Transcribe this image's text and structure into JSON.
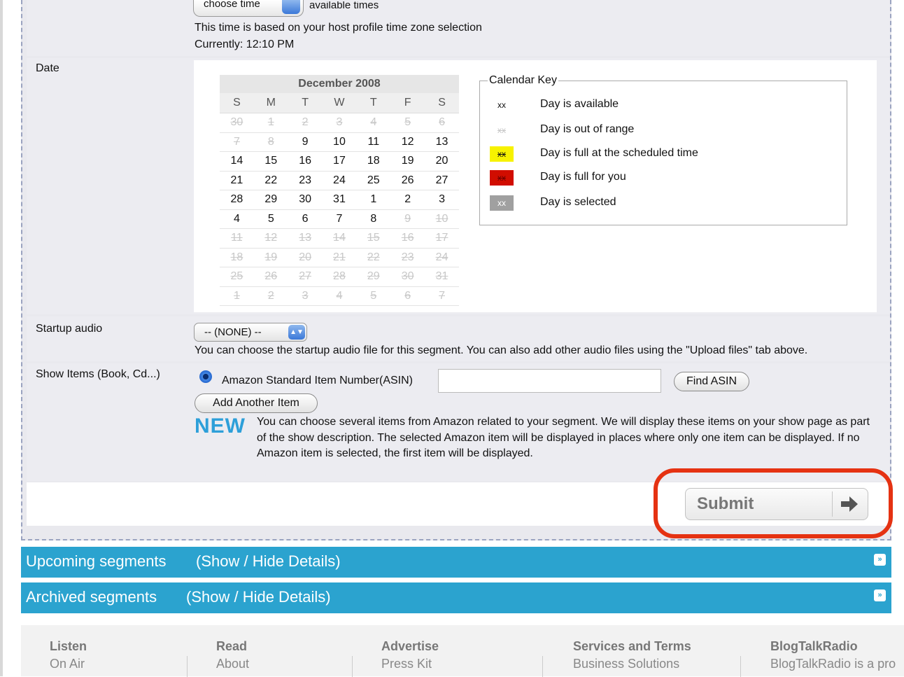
{
  "time_row": {
    "select_value": "choose time",
    "available_note": "available times",
    "note": "This time is based on your host profile time zone selection",
    "current": "Currently: 12:10 PM"
  },
  "date_row": {
    "label": "Date",
    "calendar": {
      "month": "December 2008",
      "weekdays": [
        "S",
        "M",
        "T",
        "W",
        "T",
        "F",
        "S"
      ],
      "weeks": [
        [
          {
            "d": "30",
            "out": true
          },
          {
            "d": "1",
            "out": true
          },
          {
            "d": "2",
            "out": true
          },
          {
            "d": "3",
            "out": true
          },
          {
            "d": "4",
            "out": true
          },
          {
            "d": "5",
            "out": true
          },
          {
            "d": "6",
            "out": true
          }
        ],
        [
          {
            "d": "7",
            "out": true
          },
          {
            "d": "8",
            "out": true
          },
          {
            "d": "9",
            "out": false
          },
          {
            "d": "10",
            "out": false
          },
          {
            "d": "11",
            "out": false
          },
          {
            "d": "12",
            "out": false
          },
          {
            "d": "13",
            "out": false
          }
        ],
        [
          {
            "d": "14",
            "out": false
          },
          {
            "d": "15",
            "out": false
          },
          {
            "d": "16",
            "out": false
          },
          {
            "d": "17",
            "out": false
          },
          {
            "d": "18",
            "out": false
          },
          {
            "d": "19",
            "out": false
          },
          {
            "d": "20",
            "out": false
          }
        ],
        [
          {
            "d": "21",
            "out": false
          },
          {
            "d": "22",
            "out": false
          },
          {
            "d": "23",
            "out": false
          },
          {
            "d": "24",
            "out": false
          },
          {
            "d": "25",
            "out": false
          },
          {
            "d": "26",
            "out": false
          },
          {
            "d": "27",
            "out": false
          }
        ],
        [
          {
            "d": "28",
            "out": false
          },
          {
            "d": "29",
            "out": false
          },
          {
            "d": "30",
            "out": false
          },
          {
            "d": "31",
            "out": false
          },
          {
            "d": "1",
            "out": false
          },
          {
            "d": "2",
            "out": false
          },
          {
            "d": "3",
            "out": false
          }
        ],
        [
          {
            "d": "4",
            "out": false
          },
          {
            "d": "5",
            "out": false
          },
          {
            "d": "6",
            "out": false
          },
          {
            "d": "7",
            "out": false
          },
          {
            "d": "8",
            "out": false
          },
          {
            "d": "9",
            "out": true
          },
          {
            "d": "10",
            "out": true
          }
        ],
        [
          {
            "d": "11",
            "out": true
          },
          {
            "d": "12",
            "out": true
          },
          {
            "d": "13",
            "out": true
          },
          {
            "d": "14",
            "out": true
          },
          {
            "d": "15",
            "out": true
          },
          {
            "d": "16",
            "out": true
          },
          {
            "d": "17",
            "out": true
          }
        ],
        [
          {
            "d": "18",
            "out": true
          },
          {
            "d": "19",
            "out": true
          },
          {
            "d": "20",
            "out": true
          },
          {
            "d": "21",
            "out": true
          },
          {
            "d": "22",
            "out": true
          },
          {
            "d": "23",
            "out": true
          },
          {
            "d": "24",
            "out": true
          }
        ],
        [
          {
            "d": "25",
            "out": true
          },
          {
            "d": "26",
            "out": true
          },
          {
            "d": "27",
            "out": true
          },
          {
            "d": "28",
            "out": true
          },
          {
            "d": "29",
            "out": true
          },
          {
            "d": "30",
            "out": true
          },
          {
            "d": "31",
            "out": true
          }
        ],
        [
          {
            "d": "1",
            "out": true
          },
          {
            "d": "2",
            "out": true
          },
          {
            "d": "3",
            "out": true
          },
          {
            "d": "4",
            "out": true
          },
          {
            "d": "5",
            "out": true
          },
          {
            "d": "6",
            "out": true
          },
          {
            "d": "7",
            "out": true
          }
        ]
      ]
    },
    "key": {
      "legend": "Calendar Key",
      "items": [
        {
          "swatch": "xx",
          "text": "Day is available",
          "bg": "transparent",
          "fg": "#111111",
          "strike": false
        },
        {
          "swatch": "xx",
          "text": "Day is out of range",
          "bg": "transparent",
          "fg": "#c8c8c8",
          "strike": true
        },
        {
          "swatch": "xx",
          "text": "Day is full at the scheduled time",
          "bg": "#f7f200",
          "fg": "#111111",
          "strike": true
        },
        {
          "swatch": "xx",
          "text": "Day is full for you",
          "bg": "#d10d00",
          "fg": "#6b0000",
          "strike": true
        },
        {
          "swatch": "xx",
          "text": "Day is selected",
          "bg": "#a0a0a0",
          "fg": "#ffffff",
          "strike": false
        }
      ]
    }
  },
  "audio_row": {
    "label": "Startup audio",
    "select_value": "-- (NONE) --",
    "note": "You can choose the startup audio file for this segment. You can also add other audio files using the \"Upload files\" tab above."
  },
  "items_row": {
    "label": "Show Items (Book, Cd...)",
    "radio_label": "Amazon Standard Item Number(ASIN)",
    "asin_value": "",
    "find_button": "Find ASIN",
    "add_button": "Add Another Item",
    "new_badge": "NEW",
    "description": "You can choose several items from Amazon related to your segment. We will display these items on your show page as part of the show description. The selected Amazon item will be displayed in places where only one item can be displayed. If no Amazon item is selected, the first item will be displayed."
  },
  "submit": {
    "label": "Submit",
    "highlight_color": "#e53212"
  },
  "segments": {
    "upcoming": {
      "title": "Upcoming segments",
      "toggle": "(Show / Hide Details)"
    },
    "archived": {
      "title": "Archived segments",
      "toggle": "(Show / Hide Details)"
    }
  },
  "footer": {
    "columns": [
      {
        "head": "Listen",
        "link": "On Air"
      },
      {
        "head": "Read",
        "link": "About"
      },
      {
        "head": "Advertise",
        "link": "Press Kit"
      },
      {
        "head": "Services and Terms",
        "link": "Business Solutions"
      },
      {
        "head": "BlogTalkRadio",
        "link": "BlogTalkRadio is a pro"
      }
    ]
  },
  "colors": {
    "accent_blue": "#2ba3cf",
    "new_blue": "#2d9fd9"
  }
}
